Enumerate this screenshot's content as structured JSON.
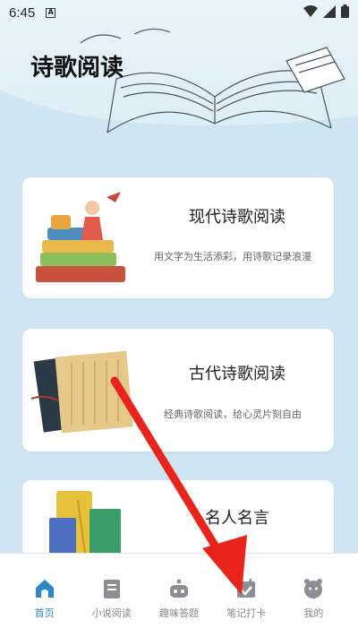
{
  "status": {
    "time": "6:45",
    "indicator": "A"
  },
  "header": {
    "title": "诗歌阅读"
  },
  "cards": [
    {
      "title": "现代诗歌阅读",
      "subtitle": "用文字为生活添彩，用诗歌记录浪漫"
    },
    {
      "title": "古代诗歌阅读",
      "subtitle": "经典诗歌阅读，给心灵片刻自由"
    },
    {
      "title": "名人名言",
      "subtitle": ""
    }
  ],
  "tabbar": {
    "items": [
      {
        "label": "首页",
        "icon": "home-icon",
        "active": true
      },
      {
        "label": "小说阅读",
        "icon": "book-icon",
        "active": false
      },
      {
        "label": "趣味答题",
        "icon": "quiz-robot-icon",
        "active": false
      },
      {
        "label": "笔记打卡",
        "icon": "calendar-check-icon",
        "active": false
      },
      {
        "label": "我的",
        "icon": "profile-face-icon",
        "active": false
      }
    ]
  },
  "colors": {
    "accent": "#2e88c6",
    "background": "#cfe6f2",
    "annotation_arrow": "#e8241c"
  }
}
